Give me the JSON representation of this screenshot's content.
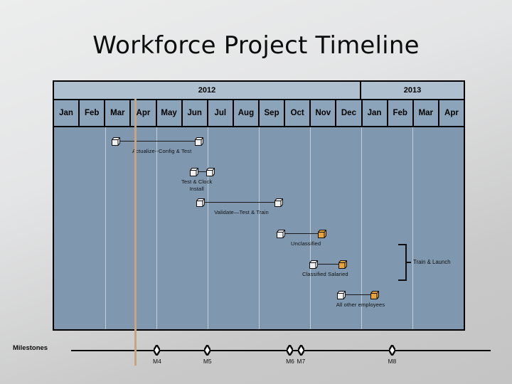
{
  "slide": {
    "title": "Workforce Project Timeline",
    "background_color": "#e0e1e2"
  },
  "chart_data": {
    "type": "bar",
    "chart_kind": "gantt-timeline",
    "title": "Workforce Project Timeline",
    "xlabel": "",
    "ylabel": "",
    "grid": true,
    "legend_position": "none",
    "plot_background_color": "#7f98b0",
    "header_year_color": "#aebfcf",
    "header_month_color": "#8ba4ba",
    "accent_color": "#e8a33d",
    "marker_line_color": "#c6a57f",
    "years": [
      {
        "label": "2012",
        "months": 12
      },
      {
        "label": "2013",
        "months": 4
      }
    ],
    "months": [
      "Jan",
      "Feb",
      "Mar",
      "Apr",
      "May",
      "Jun",
      "Jul",
      "Aug",
      "Sep",
      "Oct",
      "Nov",
      "Dec",
      "Jan",
      "Feb",
      "Mar",
      "Apr"
    ],
    "axis_range": [
      "2012-Jan",
      "2013-Apr"
    ],
    "today_marker": {
      "label": "",
      "position_month": "2012-Apr"
    },
    "tasks": [
      {
        "label": "Actualize--Config & Test",
        "start_month": "2012-Mar",
        "end_month": "2012-Jun",
        "start_index": 2.25,
        "end_index": 5.5,
        "start_marker_color": "#f2f2f2",
        "end_marker_color": "#f2f2f2"
      },
      {
        "label": "Test & Clock Install",
        "start_month": "2012-Jun",
        "end_month": "2012-Jul",
        "start_index": 5.3,
        "end_index": 5.95,
        "start_marker_color": "#f2f2f2",
        "end_marker_color": "#f2f2f2"
      },
      {
        "label": "Validate—Test & Train",
        "start_month": "2012-Jun",
        "end_month": "2012-Sep",
        "start_index": 5.55,
        "end_index": 8.6,
        "start_marker_color": "#f2f2f2",
        "end_marker_color": "#f2f2f2"
      },
      {
        "label": "Unclassified",
        "start_month": "2012-Sep",
        "end_month": "2012-Oct",
        "start_index": 8.7,
        "end_index": 10.3,
        "start_marker_color": "#f2f2f2",
        "end_marker_color": "#e8a33d"
      },
      {
        "label": "Classified Salaried",
        "start_month": "2012-Oct",
        "end_month": "2012-Nov",
        "start_index": 9.98,
        "end_index": 11.1,
        "start_marker_color": "#f2f2f2",
        "end_marker_color": "#e8a33d"
      },
      {
        "label": "All other employees",
        "start_month": "2012-Nov",
        "end_month": "2012-Dec",
        "start_index": 11.05,
        "end_index": 12.35,
        "start_marker_color": "#f2f2f2",
        "end_marker_color": "#e8a33d"
      }
    ],
    "annotations": [
      {
        "label": "Train & Launch",
        "type": "bracket",
        "spans_tasks": [
          "Unclassified",
          "Classified Salaried",
          "All other employees"
        ]
      }
    ],
    "milestones": [
      {
        "label": "M4",
        "month": "2012-Apr",
        "x_ratio": 0.205
      },
      {
        "label": "M5",
        "month": "2012-Jun",
        "x_ratio": 0.325
      },
      {
        "label": "M6",
        "month": "2012-Sep",
        "x_ratio": 0.522
      },
      {
        "label": "M7",
        "month": "2012-Sep",
        "x_ratio": 0.548
      },
      {
        "label": "M8",
        "month": "2012-Dec",
        "x_ratio": 0.765
      }
    ],
    "milestones_row_label": "Milestones"
  }
}
